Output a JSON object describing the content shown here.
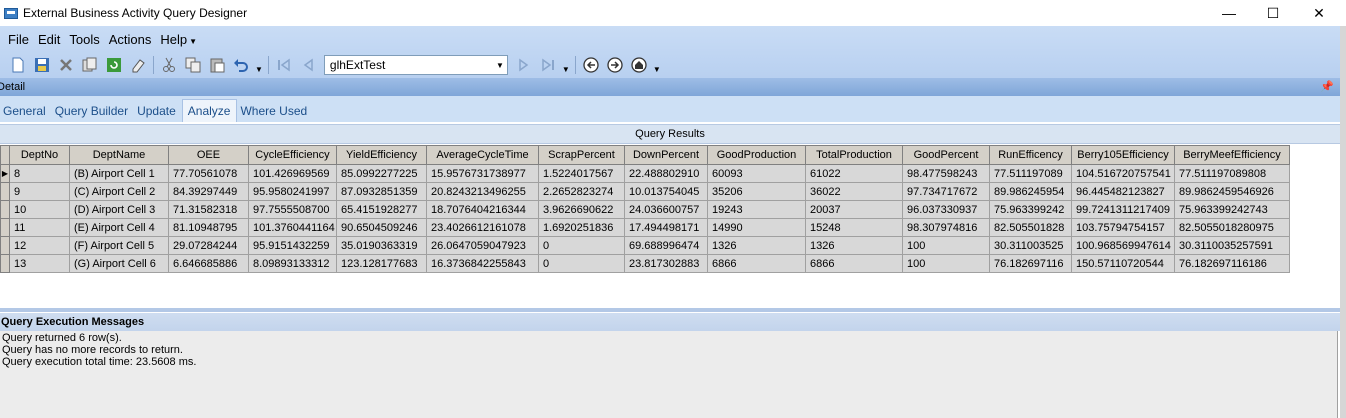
{
  "window": {
    "title": "External Business Activity Query Designer",
    "controls": {
      "minimize": "—",
      "maximize": "☐",
      "close": "✕"
    }
  },
  "menu": [
    {
      "label": "File"
    },
    {
      "label": "Edit"
    },
    {
      "label": "Tools"
    },
    {
      "label": "Actions"
    },
    {
      "label": "Help"
    }
  ],
  "toolbar": {
    "query_selector": {
      "value": "glhExtTest"
    }
  },
  "detail": {
    "label": "Detail"
  },
  "tabs": [
    {
      "label": "General"
    },
    {
      "label": "Query Builder"
    },
    {
      "label": "Update"
    },
    {
      "label": "Analyze",
      "active": true
    },
    {
      "label": "Where Used"
    }
  ],
  "results": {
    "title": "Query Results",
    "columns": [
      "DeptNo",
      "DeptName",
      "OEE",
      "CycleEfficiency",
      "YieldEfficiency",
      "AverageCycleTime",
      "ScrapPercent",
      "DownPercent",
      "GoodProduction",
      "TotalProduction",
      "GoodPercent",
      "RunEfficency",
      "Berry105Efficiency",
      "BerryMeefEfficiency"
    ],
    "rows": [
      [
        "8",
        "(B) Airport Cell 1",
        "77.70561078",
        "101.426969569",
        "85.0992277225",
        "15.9576731738977",
        "1.5224017567",
        "22.488802910",
        "60093",
        "61022",
        "98.477598243",
        "77.511197089",
        "104.516720757541",
        "77.511197089808"
      ],
      [
        "9",
        "(C) Airport Cell 2",
        "84.39297449",
        "95.9580241997",
        "87.0932851359",
        "20.8243213496255",
        "2.2652823274",
        "10.013754045",
        "35206",
        "36022",
        "97.734717672",
        "89.986245954",
        "96.445482123827",
        "89.9862459546926"
      ],
      [
        "10",
        "(D) Airport Cell 3",
        "71.31582318",
        "97.7555508700",
        "65.4151928277",
        "18.7076404216344",
        "3.9626690622",
        "24.036600757",
        "19243",
        "20037",
        "96.037330937",
        "75.963399242",
        "99.7241311217409",
        "75.963399242743"
      ],
      [
        "11",
        "(E) Airport Cell 4",
        "81.10948795",
        "101.3760441164",
        "90.6504509246",
        "23.4026612161078",
        "1.6920251836",
        "17.494498171",
        "14990",
        "15248",
        "98.307974816",
        "82.505501828",
        "103.75794754157",
        "82.5055018280975"
      ],
      [
        "12",
        "(F) Airport Cell 5",
        "29.07284244",
        "95.9151432259",
        "35.0190363319",
        "26.0647059047923",
        "0",
        "69.688996474",
        "1326",
        "1326",
        "100",
        "30.311003525",
        "100.968569947614",
        "30.3110035257591"
      ],
      [
        "13",
        "(G) Airport Cell 6",
        "6.646685886",
        "8.09893133312",
        "123.128177683",
        "16.3736842255843",
        "0",
        "23.817302883",
        "6866",
        "6866",
        "100",
        "76.182697116",
        "150.57110720544",
        "76.182697116186"
      ]
    ]
  },
  "messages": {
    "title": "Query Execution Messages",
    "lines": [
      "Query returned 6 row(s).",
      "Query has no more records to return.",
      "Query execution total time: 23.5608 ms."
    ]
  },
  "icons": {
    "current_row": "▶"
  }
}
